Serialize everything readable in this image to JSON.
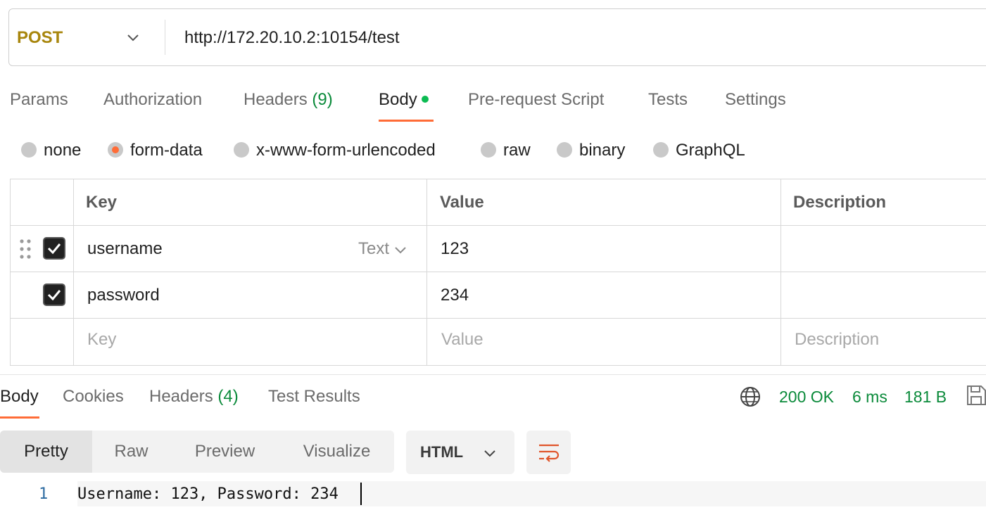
{
  "request": {
    "method": "POST",
    "url": "http://172.20.10.2:10154/test",
    "tabs": {
      "params": "Params",
      "authorization": "Authorization",
      "headers": "Headers",
      "headers_count": "(9)",
      "body": "Body",
      "prerequest": "Pre-request Script",
      "tests": "Tests",
      "settings": "Settings"
    },
    "body_types": [
      "none",
      "form-data",
      "x-www-form-urlencoded",
      "raw",
      "binary",
      "GraphQL"
    ],
    "selected_body_type": "form-data",
    "table": {
      "headers": {
        "key": "Key",
        "value": "Value",
        "description": "Description"
      },
      "rows": [
        {
          "key": "username",
          "type": "Text",
          "value": "123",
          "checked": true
        },
        {
          "key": "password",
          "value": "234",
          "checked": true
        }
      ],
      "placeholders": {
        "key": "Key",
        "value": "Value",
        "description": "Description"
      }
    }
  },
  "response": {
    "tabs": {
      "body": "Body",
      "cookies": "Cookies",
      "headers": "Headers",
      "headers_count": "(4)",
      "test_results": "Test Results"
    },
    "status": "200 OK",
    "time": "6 ms",
    "size": "181 B",
    "views": [
      "Pretty",
      "Raw",
      "Preview",
      "Visualize"
    ],
    "format": "HTML",
    "line_number": "1",
    "content": "Username: 123, Password: 234"
  },
  "colors": {
    "accent": "#ff6c37",
    "success": "#0a8a3a",
    "method": "#a8860d"
  }
}
